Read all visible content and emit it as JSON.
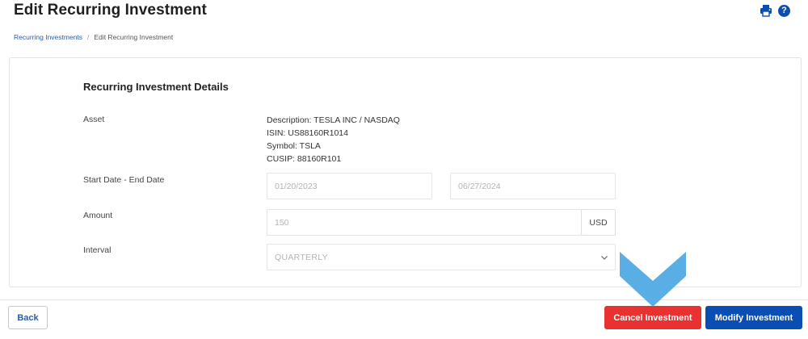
{
  "header": {
    "title": "Edit Recurring Investment",
    "icons": [
      "print-icon",
      "help-icon"
    ],
    "help_glyph": "?"
  },
  "breadcrumb": {
    "items": [
      "Recurring Investments",
      "Edit Recurring Investment"
    ],
    "separator": "/"
  },
  "details": {
    "section_title": "Recurring Investment Details",
    "asset": {
      "label": "Asset",
      "description": "Description: TESLA INC / NASDAQ",
      "isin": "ISIN: US88160R1014",
      "symbol": "Symbol: TSLA",
      "cusip": "CUSIP: 88160R101"
    },
    "dates": {
      "label": "Start Date - End Date",
      "start_value": "01/20/2023",
      "end_value": "06/27/2024"
    },
    "amount": {
      "label": "Amount",
      "value": "150",
      "currency": "USD"
    },
    "interval": {
      "label": "Interval",
      "selected": "QUARTERLY"
    }
  },
  "footer": {
    "back_label": "Back",
    "cancel_label": "Cancel Investment",
    "modify_label": "Modify Investment"
  },
  "colors": {
    "brand_blue": "#0b4eb3",
    "danger_red": "#e83232",
    "link_blue": "#2a5ea8",
    "annotation_arrow": "#5aaee6"
  }
}
